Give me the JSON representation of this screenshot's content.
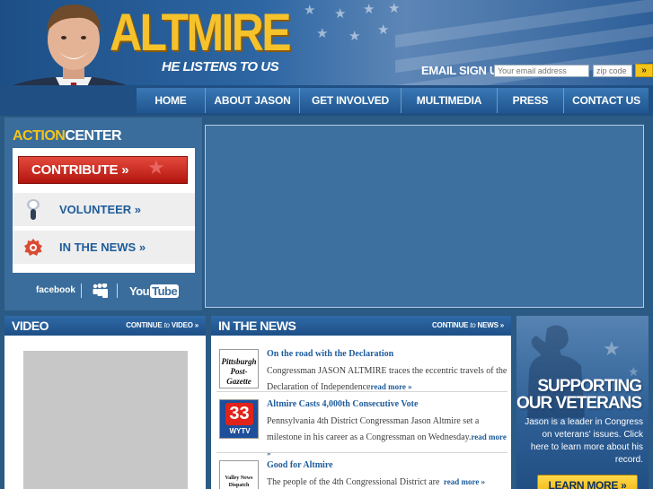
{
  "header": {
    "logo_text": "ALTMIRE",
    "tagline": "HE LISTENS TO US",
    "email_label": "EMAIL SIGN UP",
    "email_placeholder": "Your email address",
    "zip_placeholder": "zip code",
    "submit_glyph": "»"
  },
  "nav": {
    "items": [
      {
        "label": "HOME"
      },
      {
        "label": "ABOUT JASON"
      },
      {
        "label": "GET INVOLVED"
      },
      {
        "label": "MULTIMEDIA"
      },
      {
        "label": "PRESS"
      },
      {
        "label": "CONTACT US"
      }
    ]
  },
  "action_center": {
    "title_accent": "ACTION",
    "title_rest": "CENTER",
    "contribute_label": "CONTRIBUTE »",
    "volunteer_label": "VOLUNTEER »",
    "in_the_news_label": "IN THE NEWS »",
    "social": {
      "facebook": "facebook",
      "youtube_you": "You",
      "youtube_tube": "Tube"
    }
  },
  "video": {
    "title": "VIDEO",
    "more_prefix": "CONTINUE",
    "more_suffix": "VIDEO »"
  },
  "news": {
    "title": "IN THE NEWS",
    "more_prefix": "CONTINUE",
    "more_suffix": "NEWS »",
    "items": [
      {
        "headline": "On the road with the Declaration",
        "summary": "Congressman JASON ALTMIRE traces the eccentric travels of the Declaration of Independence",
        "read_more": "read more »",
        "source": "Pittsburgh Post-Gazette"
      },
      {
        "headline": "Altmire Casts 4,000th Consecutive Vote",
        "summary": "Pennsylvania 4th District Congressman Jason Altmire set a milestone in his career as a Congressman on Wednesday.",
        "read_more": "read more »",
        "source_channel": "33",
        "source_station": "WYTV"
      },
      {
        "headline": "Good for Altmire",
        "summary": "The people of the 4th Congressional District are",
        "read_more": "read more »",
        "source": "Valley News Dispatch"
      }
    ]
  },
  "veterans": {
    "title_line1": "SUPPORTING",
    "title_line2": "OUR VETERANS",
    "text": "Jason is a leader in Congress on veterans' issues. Click here to learn more about his record.",
    "button_label": "LEARN MORE »"
  },
  "colors": {
    "accent_gold": "#f4c41a",
    "nav_blue": "#20568f",
    "panel_blue": "#3a6d9b",
    "contribute_red": "#b3150f",
    "link_blue": "#1f5c9b"
  }
}
